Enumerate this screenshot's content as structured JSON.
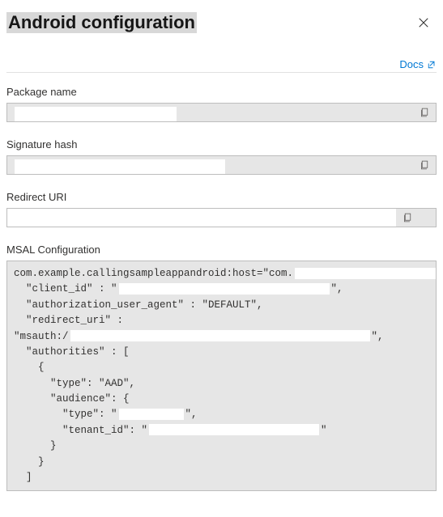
{
  "header": {
    "title": "Android configuration"
  },
  "docs_link": "Docs",
  "fields": {
    "package_name": {
      "label": "Package name"
    },
    "signature_hash": {
      "label": "Signature hash"
    },
    "redirect_uri": {
      "label": "Redirect URI"
    }
  },
  "msal": {
    "label": "MSAL Configuration",
    "line_prefix": "com.example.callingsampleappandroid:host=\"com.",
    "line_suffix": "\"{",
    "client_id_key": "  \"client_id\" : \"",
    "client_id_end": "\",",
    "auth_agent": "  \"authorization_user_agent\" : \"DEFAULT\",",
    "redirect_uri_key": "  \"redirect_uri\" :",
    "msauth_prefix": "\"msauth:/",
    "msauth_end": "\",",
    "authorities": "  \"authorities\" : [",
    "brace_open": "    {",
    "type_aad": "      \"type\": \"AAD\",",
    "audience_open": "      \"audience\": {",
    "aud_type": "        \"type\": \"",
    "aud_type_end": "\",",
    "tenant_id": "        \"tenant_id\": \"",
    "tenant_id_end": "\"",
    "brace_close_inner": "      }",
    "brace_close_mid": "    }",
    "bracket_close": "  ]"
  }
}
